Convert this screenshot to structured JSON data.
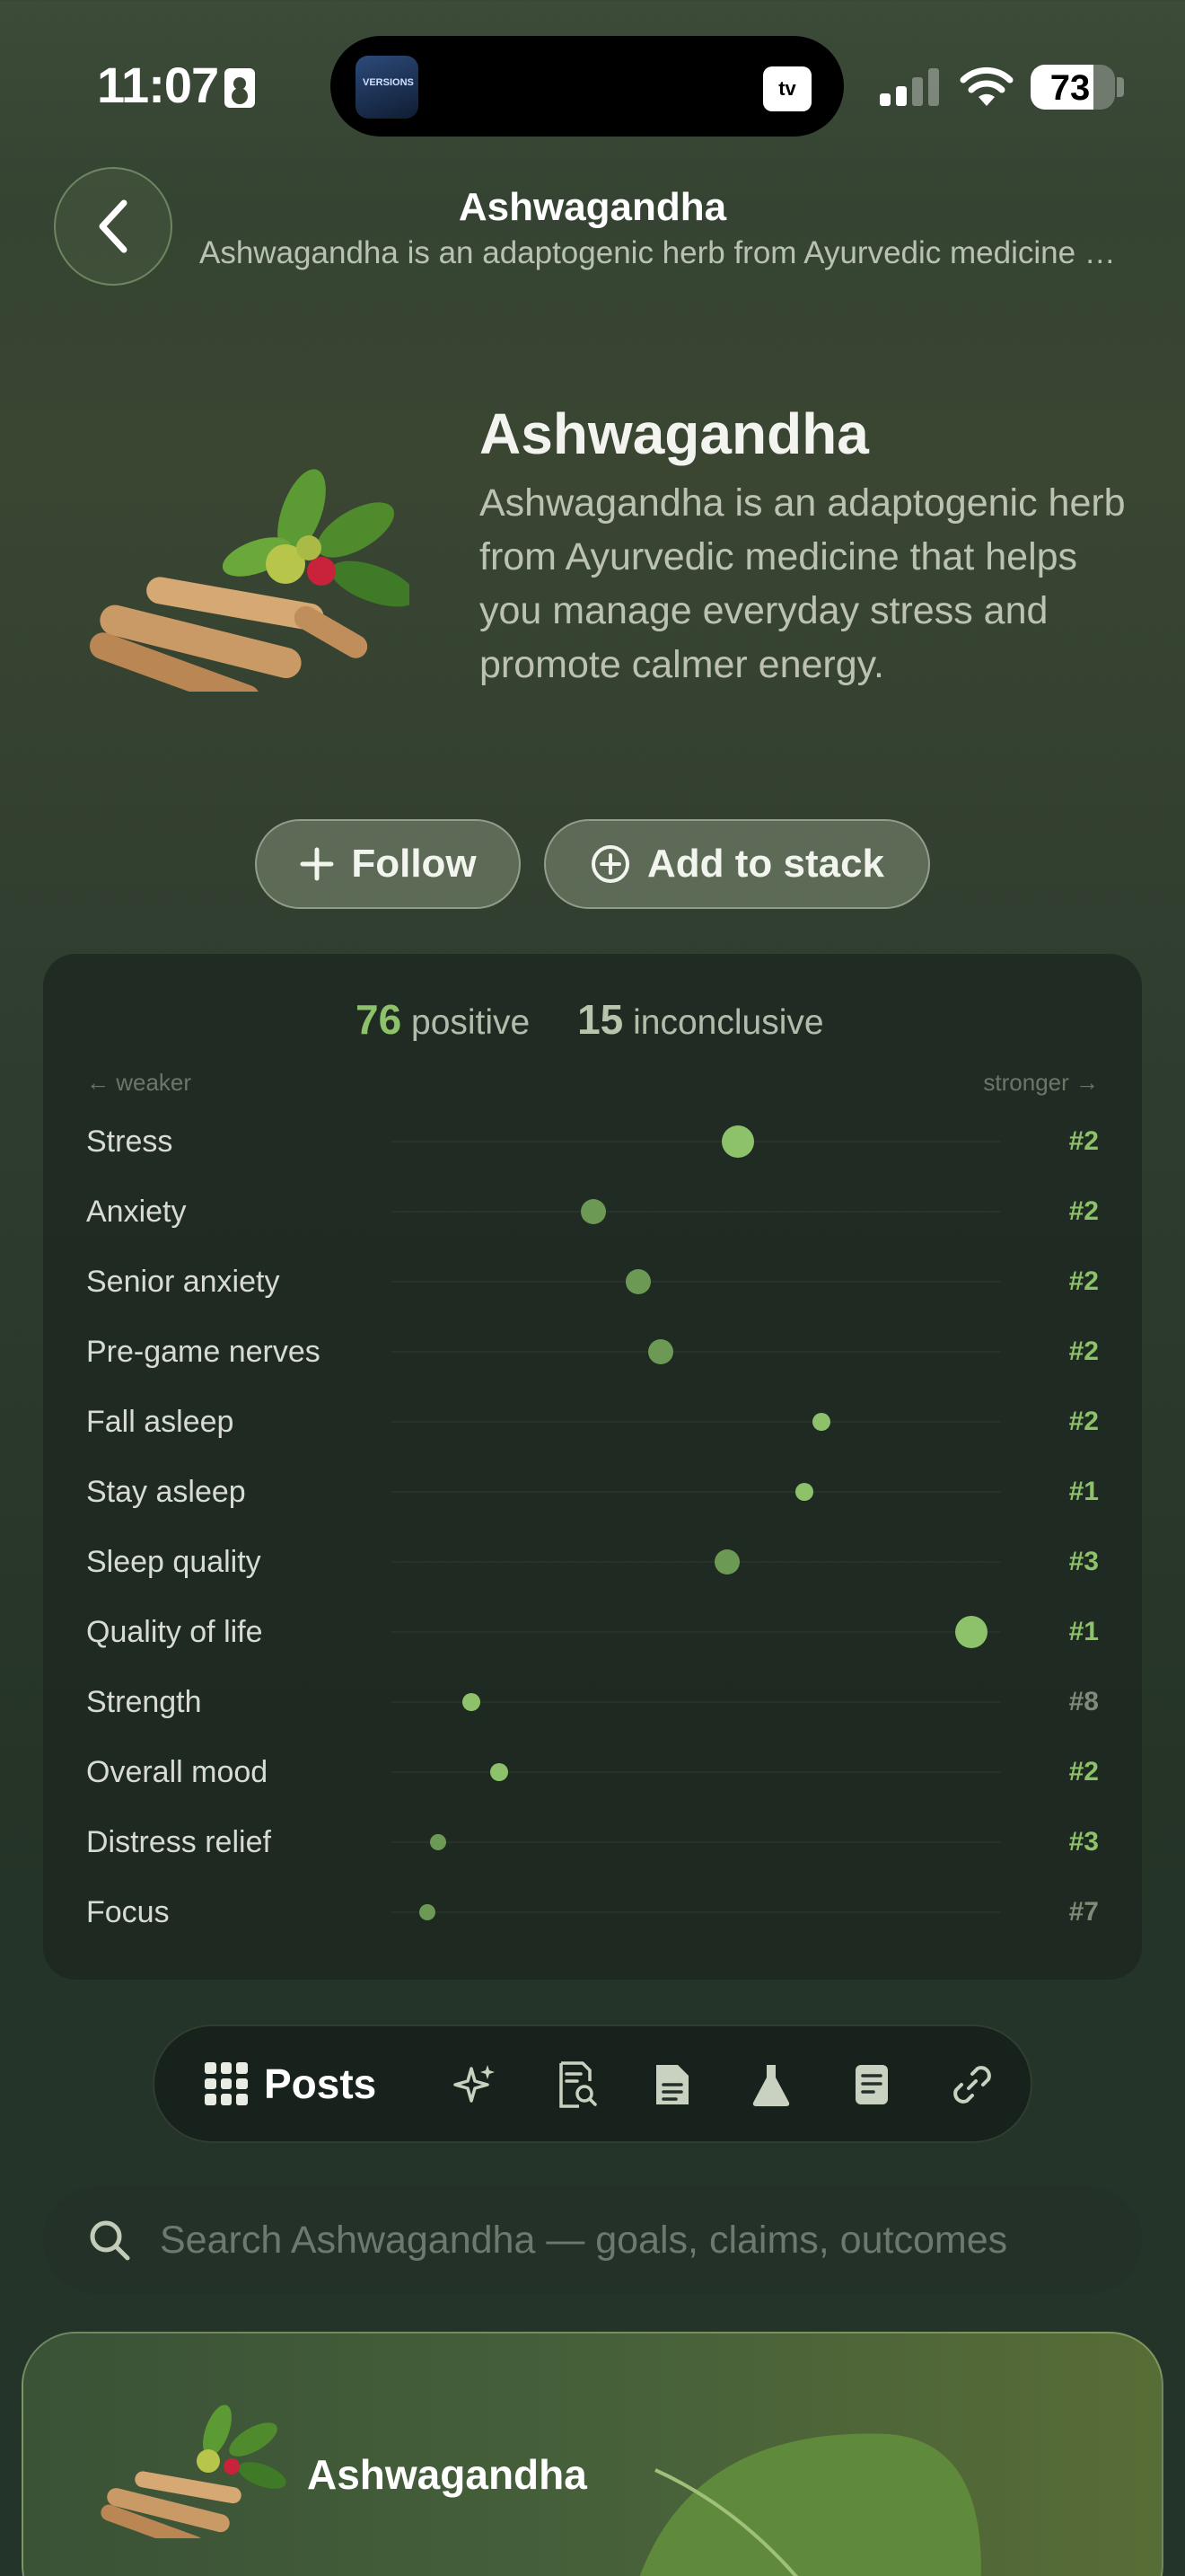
{
  "status_bar": {
    "time": "11:07",
    "battery": "73",
    "tv_label": "tv",
    "now_playing_label": "VERSIONS"
  },
  "header": {
    "title": "Ashwagandha",
    "subtitle": "Ashwagandha is an adaptogenic herb from Ayurvedic medicine that helps you manage everyday stress and promote calmer energy."
  },
  "hero": {
    "title": "Ashwagandha",
    "description": "Ashwagandha is an adaptogenic herb from Ayurvedic medicine that helps you manage everyday stress and promote calmer energy."
  },
  "actions": {
    "follow_label": "Follow",
    "stack_label": "Add to stack"
  },
  "outcomes": {
    "positive_count": "76",
    "positive_label": "positive",
    "inconclusive_count": "15",
    "inconclusive_label": "inconclusive",
    "weaker_label": "← weaker",
    "stronger_label": "stronger →",
    "rows": [
      {
        "label": "Stress",
        "rank": "#2",
        "strength": 0.56,
        "size": "large",
        "tone": "bright"
      },
      {
        "label": "Anxiety",
        "rank": "#2",
        "strength": 0.3,
        "size": "medium",
        "tone": "muted"
      },
      {
        "label": "Senior anxiety",
        "rank": "#2",
        "strength": 0.38,
        "size": "medium",
        "tone": "muted"
      },
      {
        "label": "Pre-game nerves",
        "rank": "#2",
        "strength": 0.42,
        "size": "medium",
        "tone": "muted"
      },
      {
        "label": "Fall asleep",
        "rank": "#2",
        "strength": 0.71,
        "size": "small",
        "tone": "bright"
      },
      {
        "label": "Stay asleep",
        "rank": "#1",
        "strength": 0.68,
        "size": "small",
        "tone": "bright"
      },
      {
        "label": "Sleep quality",
        "rank": "#3",
        "strength": 0.54,
        "size": "medium",
        "tone": "muted"
      },
      {
        "label": "Quality of life",
        "rank": "#1",
        "strength": 0.98,
        "size": "large",
        "tone": "bright"
      },
      {
        "label": "Strength",
        "rank": "#8",
        "strength": 0.08,
        "size": "small",
        "tone": "bright"
      },
      {
        "label": "Overall mood",
        "rank": "#2",
        "strength": 0.13,
        "size": "small",
        "tone": "bright"
      },
      {
        "label": "Distress relief",
        "rank": "#3",
        "strength": 0.02,
        "size": "xsmall",
        "tone": "muted"
      },
      {
        "label": "Focus",
        "rank": "#7",
        "strength": 0.0,
        "size": "xsmall",
        "tone": "muted"
      }
    ]
  },
  "tabs": {
    "posts_label": "Posts",
    "icons": [
      "sparkles-icon",
      "document-search-icon",
      "document-icon",
      "flask-icon",
      "notes-icon",
      "link-icon"
    ]
  },
  "search": {
    "placeholder": "Search Ashwagandha — goals, claims, outcomes"
  },
  "featured": {
    "title": "Ashwagandha"
  },
  "colors": {
    "accent": "#8ec26a",
    "accent_muted": "#6c9a54",
    "rank_gray": "#7f8b78"
  }
}
